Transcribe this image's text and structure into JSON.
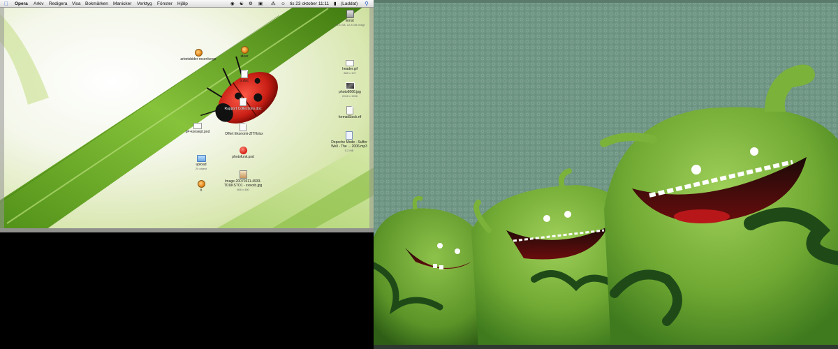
{
  "menubar": {
    "app_name": "Opera",
    "menus": [
      "Arkiv",
      "Redigera",
      "Visa",
      "Bokmärken",
      "Manicker",
      "Verktyg",
      "Fönster",
      "Hjälp"
    ],
    "clock": "tis 23 oktober 11:11",
    "battery_status": "(Laddat)"
  },
  "desktop_icons": {
    "drive": {
      "label": "Ernst",
      "sub": "74,5 GB, 12,8 GB ledigt"
    },
    "arbetsbider": {
      "label": "arbetsbider rosenkergs"
    },
    "ideer": {
      "label": "ideer"
    },
    "xdoc": {
      "label": "x.doc"
    },
    "header": {
      "label": "header.gif",
      "sub": "888 x 107"
    },
    "photo": {
      "label": "photo6666.jpg",
      "sub": "2048 x 1536"
    },
    "rapport": {
      "label": "Rapport Collections.doc"
    },
    "formatstock": {
      "label": "formatStock.rtf"
    },
    "offert": {
      "label": "Offert Ekonomi-ZITHxlsx"
    },
    "depeche": {
      "label": "Depeche Mode - Suffer Well - The ... 2006.mp3",
      "sub": "5,2 MB"
    },
    "pdf": {
      "label": "pF-konsept.pod"
    },
    "photofunk": {
      "label": "photofunk.psd"
    },
    "upload": {
      "label": "upload",
      "sub": "20 objekt"
    },
    "image": {
      "label": "Image-20070311-4933-TOUKSTO1 - xxxxxb.jpg",
      "sub": "666 x 480"
    },
    "small": {
      "label": "ô"
    }
  },
  "colors": {
    "menubar_bg": "#e8e8e8",
    "leaf_green": "#6aa92a",
    "ladybug_red": "#c81e14",
    "right_wallpaper": "#6e9484",
    "monster_green": "#7bb23a"
  },
  "icons": [
    "apple-icon",
    "bluetooth-icon",
    "wifi-icon",
    "volume-icon",
    "battery-icon",
    "spotlight-icon",
    "clock-icon"
  ]
}
